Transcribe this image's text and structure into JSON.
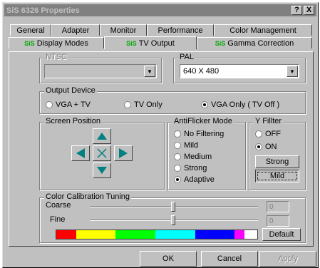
{
  "window": {
    "title": "SiS 6326 Properties",
    "help_btn": "?",
    "close_btn": "X"
  },
  "tabs_row1": [
    "General",
    "Adapter",
    "Monitor",
    "Performance",
    "Color Management"
  ],
  "tabs_row2": [
    {
      "icon": "SiS",
      "label": "Display Modes"
    },
    {
      "icon": "SiS",
      "label": "TV Output"
    },
    {
      "icon": "SiS",
      "label": "Gamma Correction"
    }
  ],
  "ntsc": {
    "label": "NTSC",
    "value": ""
  },
  "pal": {
    "label": "PAL",
    "value": "640 X 480"
  },
  "output_device": {
    "label": "Output Device",
    "options": [
      "VGA + TV",
      "TV Only",
      "VGA Only ( TV Off )"
    ],
    "selected": 2
  },
  "screen_position": {
    "label": "Screen Position"
  },
  "antiflicker": {
    "label": "AntiFlicker Mode",
    "options": [
      "No Filtering",
      "Mild",
      "Medium",
      "Strong",
      "Adaptive"
    ],
    "selected": 4
  },
  "yfilter": {
    "label": "Y Fillter",
    "options": [
      "OFF",
      "ON"
    ],
    "selected": 1,
    "strong": "Strong",
    "mild": "Mild"
  },
  "color_tuning": {
    "label": "Color Calibration Tuning",
    "coarse": {
      "label": "Coarse",
      "value": "0"
    },
    "fine": {
      "label": "Fine",
      "value": "0"
    },
    "default_btn": "Default",
    "bar_colors": [
      "#ff0000",
      "#ffff00",
      "#00ff00",
      "#00ffff",
      "#0000ff",
      "#ff00ff",
      "#ffffff"
    ]
  },
  "footer": {
    "ok": "OK",
    "cancel": "Cancel",
    "apply": "Apply"
  }
}
